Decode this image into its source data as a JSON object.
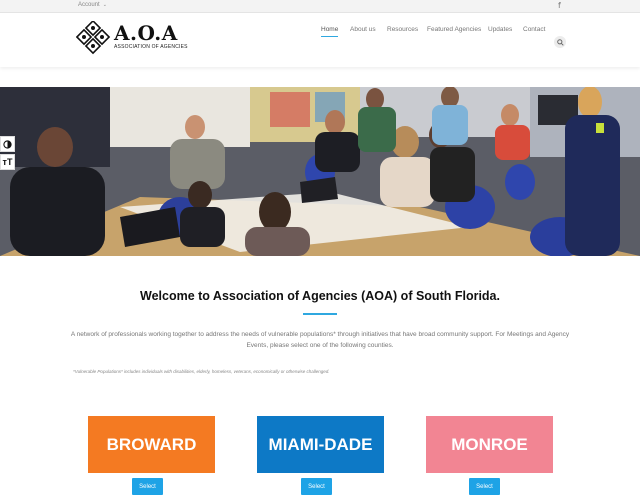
{
  "topbar": {
    "account_label": "Account",
    "account_caret": "⌄",
    "facebook_glyph": "f"
  },
  "logo": {
    "title": "A.O.A",
    "subtitle": "ASSOCIATION OF AGENCIES"
  },
  "nav": {
    "items": [
      {
        "label": "Home",
        "active": true
      },
      {
        "label": "About us",
        "active": false
      },
      {
        "label": "Resources",
        "active": false
      },
      {
        "label": "Featured Agencies",
        "active": false
      },
      {
        "label": "Updates",
        "active": false
      },
      {
        "label": "Contact",
        "active": false
      }
    ],
    "search_icon": "search-icon"
  },
  "side_tools": {
    "contrast_icon": "contrast-icon",
    "text_size_label": "тT"
  },
  "welcome": {
    "title": "Welcome to Association of Agencies (AOA) of South Florida.",
    "description": "A network of professionals working together to address the needs of vulnerable populations* through initiatives that have broad community support. For Meetings and Agency Events, please select one of the following counties.",
    "note": "*Vulnerable Populations* includes individuals with disabilities, elderly, homeless, veterans, economically or otherwise challenged."
  },
  "counties": [
    {
      "name": "BROWARD",
      "color": "#f47a22",
      "button_label": "Select"
    },
    {
      "name": "MIAMI-DADE",
      "color": "#0d79c6",
      "button_label": "Select"
    },
    {
      "name": "MONROE",
      "color": "#f28593",
      "button_label": "Select"
    }
  ],
  "colors": {
    "accent": "#2fa8e0",
    "select_button": "#1ea3e6"
  }
}
